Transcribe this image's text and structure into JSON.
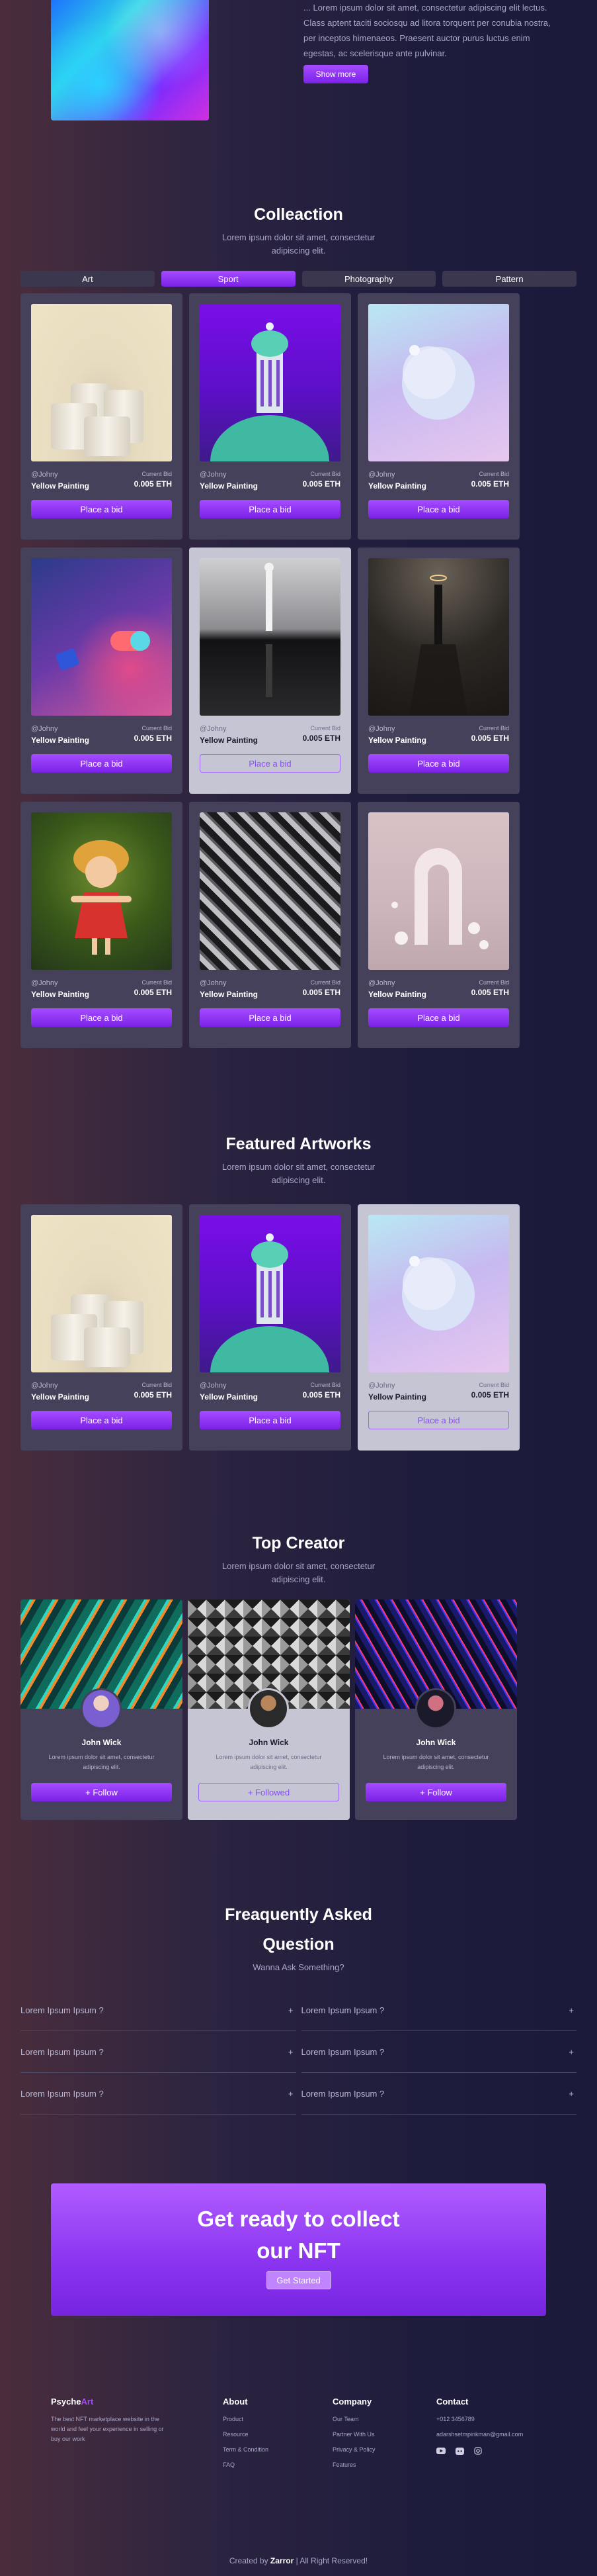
{
  "hero": {
    "text": "... Lorem ipsum dolor sit amet, consectetur adipiscing elit lectus. Class aptent taciti sociosqu ad litora torquent per conubia nostra, per inceptos himenaeos. Praesent auctor purus luctus enim egestas, ac scelerisque ante pulvinar.",
    "button": "Show more"
  },
  "collection": {
    "title": "Colleaction",
    "subtitle_line1": "Lorem ipsum dolor sit amet, consectetur",
    "subtitle_line2": "adipiscing elit.",
    "tabs": [
      "Art",
      "Sport",
      "Photography",
      "Pattern"
    ],
    "active_tab": "Sport"
  },
  "card_common": {
    "user": "@Johny",
    "name": "Yellow Painting",
    "bid_label": "Current Bid",
    "price": "0.005 ETH",
    "button": "Place a bid"
  },
  "featured": {
    "title": "Featured Artworks",
    "subtitle_line1": "Lorem ipsum dolor sit amet, consectetur",
    "subtitle_line2": "adipiscing elit."
  },
  "creator": {
    "title": "Top Creator",
    "subtitle_line1": "Lorem ipsum dolor sit amet, consectetur",
    "subtitle_line2": "adipiscing elit.",
    "cards": [
      {
        "name": "John Wick",
        "desc": "Lorem ipsum dolor sit amet, consectetur adipiscing elit.",
        "button": "+ Follow"
      },
      {
        "name": "John Wick",
        "desc": "Lorem ipsum dolor sit amet, consectetur adipiscing elit.",
        "button": "+ Followed"
      },
      {
        "name": "John Wick",
        "desc": "Lorem ipsum dolor sit amet, consectetur adipiscing elit.",
        "button": "+ Follow"
      }
    ]
  },
  "faq": {
    "title_line1": "Freaquently Asked",
    "title_line2": "Question",
    "subtitle": "Wanna Ask Something?",
    "items": [
      "Lorem Ipsum Ipsum ?",
      "Lorem Ipsum Ipsum ?",
      "Lorem Ipsum Ipsum ?",
      "Lorem Ipsum Ipsum ?",
      "Lorem Ipsum Ipsum ?",
      "Lorem Ipsum Ipsum ?"
    ],
    "plus": "+"
  },
  "cta": {
    "title_line1": "Get ready to collect",
    "title_line2": "our NFT",
    "button": "Get Started"
  },
  "footer": {
    "brand_a": "Psyche",
    "brand_b": "Art",
    "description": "The best NFT marketplace website in the world and feel your experience in selling or buy our work",
    "about": {
      "title": "About",
      "links": [
        "Product",
        "Resource",
        "Term & Condition",
        "FAQ"
      ]
    },
    "company": {
      "title": "Company",
      "links": [
        "Our Team",
        "Partner With Us",
        "Privacy & Policy",
        "Features"
      ]
    },
    "contact": {
      "title": "Contact",
      "links": [
        "+012 3456789",
        "adarshsetmpinkman@gmail.com"
      ]
    },
    "copyright_a": "Created by ",
    "copyright_b": "Zarror",
    "copyright_c": " | All Right Reserved!",
    "social_icons": [
      "youtube-icon",
      "discord-icon",
      "instagram-icon"
    ]
  },
  "colors": {
    "accent": "#a64cff",
    "accent_dark": "#7b22e8",
    "card": "#45415b",
    "card_light": "#c6c5d3"
  }
}
